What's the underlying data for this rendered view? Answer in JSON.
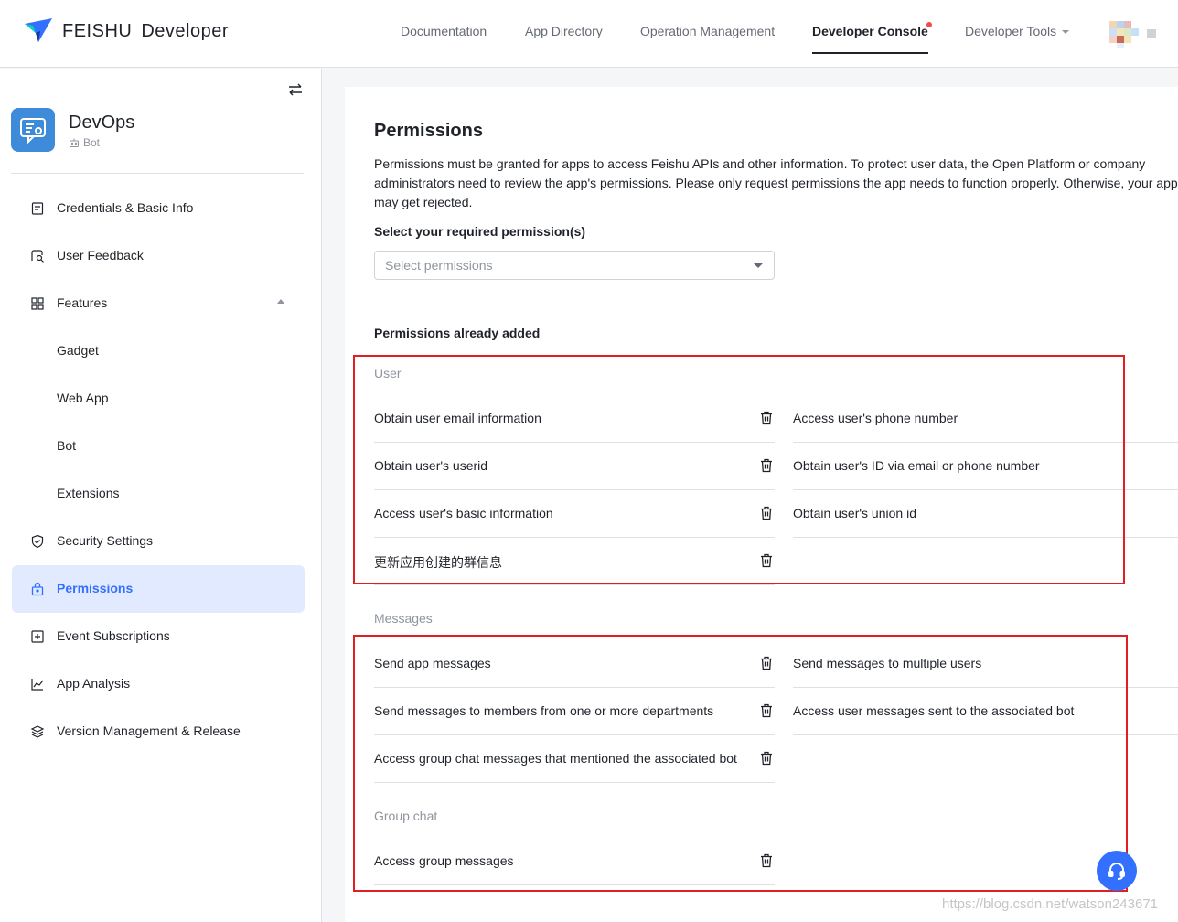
{
  "brand": {
    "name": "FEISHU",
    "sub": "Developer"
  },
  "nav": {
    "items": [
      {
        "label": "Documentation"
      },
      {
        "label": "App Directory"
      },
      {
        "label": "Operation Management"
      },
      {
        "label": "Developer Console"
      },
      {
        "label": "Developer Tools"
      }
    ]
  },
  "app": {
    "name": "DevOps",
    "type": "Bot"
  },
  "sidebar": {
    "items": [
      {
        "label": "Credentials & Basic Info",
        "icon": "document-icon"
      },
      {
        "label": "User Feedback",
        "icon": "feedback-icon"
      },
      {
        "label": "Features",
        "icon": "grid-icon"
      },
      {
        "label": "Gadget"
      },
      {
        "label": "Web App"
      },
      {
        "label": "Bot"
      },
      {
        "label": "Extensions"
      },
      {
        "label": "Security Settings",
        "icon": "shield-icon"
      },
      {
        "label": "Permissions",
        "icon": "lock-icon"
      },
      {
        "label": "Event Subscriptions",
        "icon": "plus-box-icon"
      },
      {
        "label": "App Analysis",
        "icon": "chart-icon"
      },
      {
        "label": "Version Management & Release",
        "icon": "layers-icon"
      }
    ]
  },
  "main": {
    "title": "Permissions",
    "description": "Permissions must be granted for apps to access Feishu APIs and other information. To protect user data, the Open Platform or company administrators need to review the app's permissions. Please only request permissions the app needs to function properly. Otherwise, your app may get rejected.",
    "select_label": "Select your required permission(s)",
    "select_placeholder": "Select permissions",
    "added_label": "Permissions already added",
    "groups": [
      {
        "title": "User",
        "left": [
          "Obtain user email information",
          "Obtain user's userid",
          "Access user's basic information",
          "更新应用创建的群信息"
        ],
        "right": [
          "Access user's phone number",
          "Obtain user's ID via email or phone number",
          "Obtain user's union id"
        ]
      },
      {
        "title": "Messages",
        "left": [
          "Send app messages",
          "Send messages to members from one or more departments",
          "Access group chat messages that mentioned the associated bot"
        ],
        "right": [
          "Send messages to multiple users",
          "Access user messages sent to the associated bot"
        ]
      },
      {
        "title": "Group chat",
        "left": [
          "Access group messages"
        ],
        "right": []
      }
    ]
  },
  "watermark": "https://blog.csdn.net/watson243671",
  "colors": {
    "accent": "#3370ff",
    "highlight_box": "#e02020",
    "active_bg": "#e1eaff"
  }
}
